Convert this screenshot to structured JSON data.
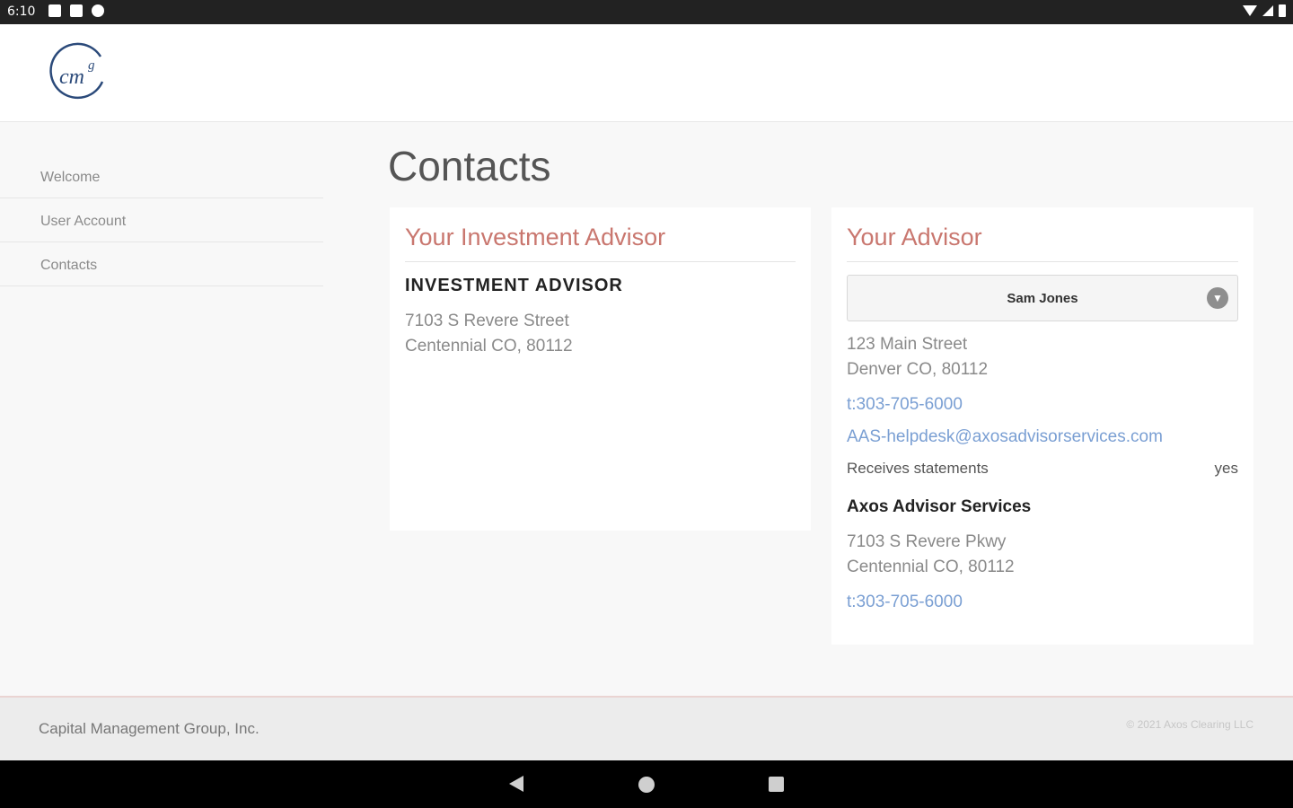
{
  "status_bar": {
    "time": "6:10"
  },
  "brand": {
    "logo_text": "cm",
    "logo_super": "g",
    "accent_color": "#c9776f",
    "logo_color": "#2b4a7a"
  },
  "sidebar": {
    "items": [
      {
        "label": "Welcome"
      },
      {
        "label": "User Account"
      },
      {
        "label": "Contacts"
      }
    ]
  },
  "page": {
    "title": "Contacts"
  },
  "investment_advisor_card": {
    "title": "Your Investment Advisor",
    "type": "INVESTMENT ADVISOR",
    "address_line1": "7103 S Revere Street",
    "address_line2": "Centennial CO, 80112"
  },
  "advisor_card": {
    "title": "Your Advisor",
    "selected_advisor": "Sam Jones",
    "address_line1": "123 Main Street",
    "address_line2": "Denver CO, 80112",
    "phone": "t:303-705-6000",
    "email": "AAS-helpdesk@axosadvisorservices.com",
    "receives_statements_label": "Receives statements",
    "receives_statements_value": "yes",
    "company": "Axos Advisor Services",
    "company_address_line1": "7103 S Revere Pkwy",
    "company_address_line2": "Centennial CO, 80112",
    "company_phone": "t:303-705-6000"
  },
  "footer": {
    "company": "Capital Management Group, Inc.",
    "copyright": "© 2021 Axos Clearing LLC"
  }
}
